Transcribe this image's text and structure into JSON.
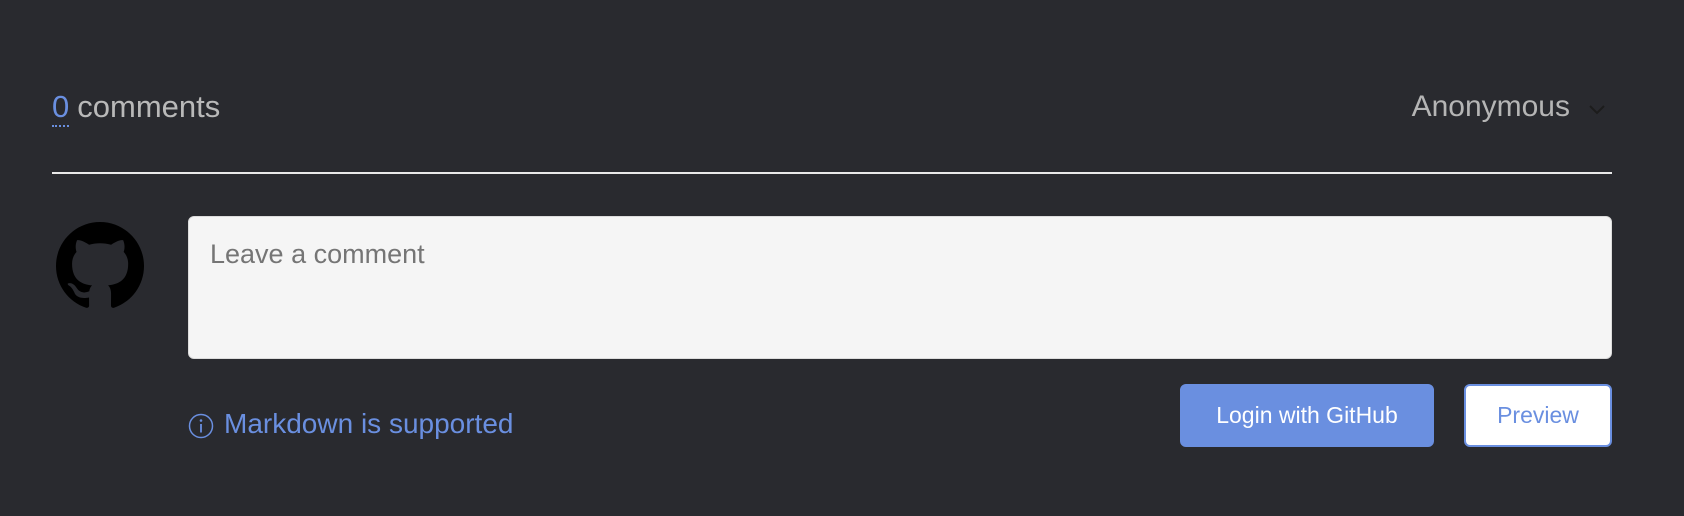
{
  "header": {
    "comment_count": "0",
    "comment_label": "comments",
    "user_selector": {
      "selected": "Anonymous",
      "icon": "chevron-down-icon"
    }
  },
  "comment_form": {
    "placeholder": "Leave a comment",
    "value": "",
    "avatar_icon": "github-icon",
    "markdown_note": {
      "icon": "info-icon",
      "text": "Markdown is supported"
    },
    "login_button_label": "Login with GitHub",
    "preview_button_label": "Preview"
  },
  "colors": {
    "background": "#292a2f",
    "accent": "#6a8fe0",
    "divider": "#e9e9e9",
    "textarea_bg": "#f5f5f5"
  }
}
